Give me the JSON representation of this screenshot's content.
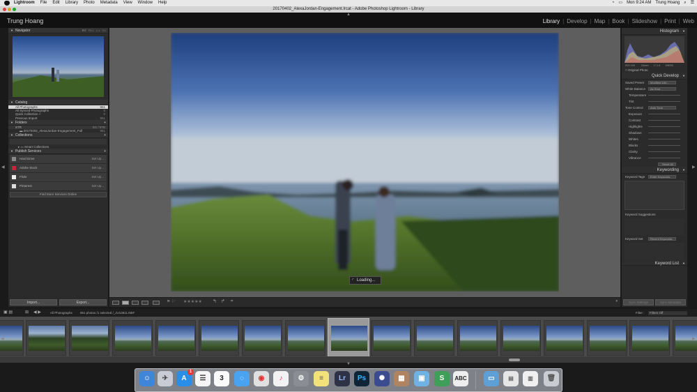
{
  "menubar": {
    "items": [
      "Lightroom",
      "File",
      "Edit",
      "Library",
      "Photo",
      "Metadata",
      "View",
      "Window",
      "Help"
    ],
    "clock": "Mon 9:24 AM",
    "user": "Trung Hoang"
  },
  "window": {
    "title": "20170402_AlexaJordan-Engagement.lrcat - Adobe Photoshop Lightroom - Library"
  },
  "header": {
    "identity_plate": "Trung Hoang",
    "modules": [
      "Library",
      "Develop",
      "Map",
      "Book",
      "Slideshow",
      "Print",
      "Web"
    ],
    "active_module": "Library"
  },
  "navigator": {
    "title": "Navigator",
    "zoom_options": [
      "FIT",
      "FILL",
      "1:1",
      "3:1"
    ]
  },
  "catalog": {
    "title": "Catalog",
    "items": [
      {
        "label": "All Photographs",
        "count": "951"
      },
      {
        "label": "All Synced Photographs",
        "count": "0"
      },
      {
        "label": "Quick Collection +",
        "count": "0"
      },
      {
        "label": "Previous Import",
        "count": "951"
      }
    ]
  },
  "folders": {
    "title": "Folders",
    "volume": "STR",
    "volume_info": "5G / 5TB",
    "folder": "20170402_AlexaJordan-Engagement_Full",
    "folder_count": "951"
  },
  "collections": {
    "title": "Collections",
    "smart": "Smart Collections"
  },
  "publish": {
    "title": "Publish Services",
    "services": [
      {
        "label": "Hard Drive",
        "setup": "Set Up..."
      },
      {
        "label": "Adobe Stock",
        "setup": "Set Up..."
      },
      {
        "label": "Flickr",
        "setup": "Set Up..."
      },
      {
        "label": "Pinterest",
        "setup": "Set Up..."
      }
    ],
    "find_more": "Find More Services Online"
  },
  "left_buttons": {
    "import": "Import...",
    "export": "Export..."
  },
  "viewer": {
    "loading_text": "Loading..."
  },
  "histogram": {
    "title": "Histogram",
    "info": [
      "ISO 100",
      "24mm",
      "f / 1.4",
      "1/8000"
    ],
    "original_photo": "Original Photo"
  },
  "quick_develop": {
    "title": "Quick Develop",
    "saved_preset_label": "Saved Preset",
    "saved_preset_value": "Modified 4A0...",
    "white_balance_label": "White Balance",
    "white_balance_value": "As Shot",
    "wb_rows": [
      "Temperature",
      "Tint"
    ],
    "tone_control_label": "Tone Control",
    "auto_tone": "Auto Tone",
    "tone_rows": [
      "Exposure",
      "Contrast",
      "Highlights",
      "Shadows",
      "Whites",
      "Blacks",
      "Clarity",
      "Vibrance"
    ],
    "reset_all": "Reset All"
  },
  "keywording": {
    "title": "Keywording",
    "tags_label": "Keyword Tags",
    "tags_value": "Enter Keywords",
    "suggestions": "Keyword Suggestions",
    "set_label": "Keyword Set",
    "set_value": "Recent Keywords",
    "keyword_list": "Keyword List"
  },
  "right_buttons": {
    "sync": "Sync Settings",
    "sync_meta": "Sync Metadata"
  },
  "filmbar": {
    "source": "All Photographs",
    "info": "951 photos /1 selected /_JU13611.NEF",
    "filter_label": "Filter :",
    "filter_value": "Filters Off"
  },
  "dock": {
    "calendar_day": "3",
    "badge": "1"
  }
}
